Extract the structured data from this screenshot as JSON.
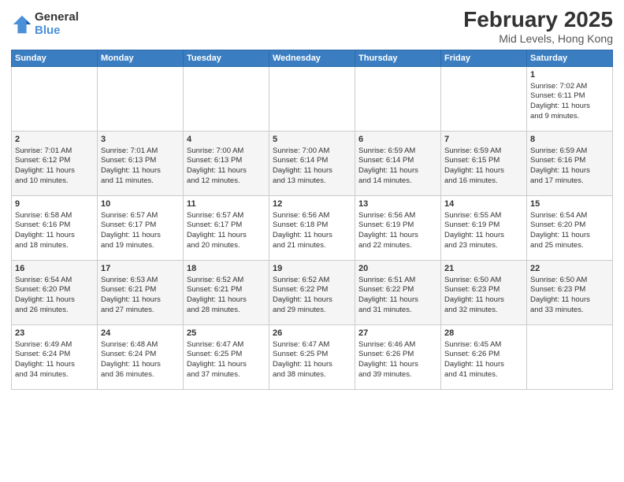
{
  "header": {
    "logo_general": "General",
    "logo_blue": "Blue",
    "title": "February 2025",
    "subtitle": "Mid Levels, Hong Kong"
  },
  "weekdays": [
    "Sunday",
    "Monday",
    "Tuesday",
    "Wednesday",
    "Thursday",
    "Friday",
    "Saturday"
  ],
  "weeks": [
    [
      {
        "day": "",
        "info": ""
      },
      {
        "day": "",
        "info": ""
      },
      {
        "day": "",
        "info": ""
      },
      {
        "day": "",
        "info": ""
      },
      {
        "day": "",
        "info": ""
      },
      {
        "day": "",
        "info": ""
      },
      {
        "day": "1",
        "info": "Sunrise: 7:02 AM\nSunset: 6:11 PM\nDaylight: 11 hours\nand 9 minutes."
      }
    ],
    [
      {
        "day": "2",
        "info": "Sunrise: 7:01 AM\nSunset: 6:12 PM\nDaylight: 11 hours\nand 10 minutes."
      },
      {
        "day": "3",
        "info": "Sunrise: 7:01 AM\nSunset: 6:13 PM\nDaylight: 11 hours\nand 11 minutes."
      },
      {
        "day": "4",
        "info": "Sunrise: 7:00 AM\nSunset: 6:13 PM\nDaylight: 11 hours\nand 12 minutes."
      },
      {
        "day": "5",
        "info": "Sunrise: 7:00 AM\nSunset: 6:14 PM\nDaylight: 11 hours\nand 13 minutes."
      },
      {
        "day": "6",
        "info": "Sunrise: 6:59 AM\nSunset: 6:14 PM\nDaylight: 11 hours\nand 14 minutes."
      },
      {
        "day": "7",
        "info": "Sunrise: 6:59 AM\nSunset: 6:15 PM\nDaylight: 11 hours\nand 16 minutes."
      },
      {
        "day": "8",
        "info": "Sunrise: 6:59 AM\nSunset: 6:16 PM\nDaylight: 11 hours\nand 17 minutes."
      }
    ],
    [
      {
        "day": "9",
        "info": "Sunrise: 6:58 AM\nSunset: 6:16 PM\nDaylight: 11 hours\nand 18 minutes."
      },
      {
        "day": "10",
        "info": "Sunrise: 6:57 AM\nSunset: 6:17 PM\nDaylight: 11 hours\nand 19 minutes."
      },
      {
        "day": "11",
        "info": "Sunrise: 6:57 AM\nSunset: 6:17 PM\nDaylight: 11 hours\nand 20 minutes."
      },
      {
        "day": "12",
        "info": "Sunrise: 6:56 AM\nSunset: 6:18 PM\nDaylight: 11 hours\nand 21 minutes."
      },
      {
        "day": "13",
        "info": "Sunrise: 6:56 AM\nSunset: 6:19 PM\nDaylight: 11 hours\nand 22 minutes."
      },
      {
        "day": "14",
        "info": "Sunrise: 6:55 AM\nSunset: 6:19 PM\nDaylight: 11 hours\nand 23 minutes."
      },
      {
        "day": "15",
        "info": "Sunrise: 6:54 AM\nSunset: 6:20 PM\nDaylight: 11 hours\nand 25 minutes."
      }
    ],
    [
      {
        "day": "16",
        "info": "Sunrise: 6:54 AM\nSunset: 6:20 PM\nDaylight: 11 hours\nand 26 minutes."
      },
      {
        "day": "17",
        "info": "Sunrise: 6:53 AM\nSunset: 6:21 PM\nDaylight: 11 hours\nand 27 minutes."
      },
      {
        "day": "18",
        "info": "Sunrise: 6:52 AM\nSunset: 6:21 PM\nDaylight: 11 hours\nand 28 minutes."
      },
      {
        "day": "19",
        "info": "Sunrise: 6:52 AM\nSunset: 6:22 PM\nDaylight: 11 hours\nand 29 minutes."
      },
      {
        "day": "20",
        "info": "Sunrise: 6:51 AM\nSunset: 6:22 PM\nDaylight: 11 hours\nand 31 minutes."
      },
      {
        "day": "21",
        "info": "Sunrise: 6:50 AM\nSunset: 6:23 PM\nDaylight: 11 hours\nand 32 minutes."
      },
      {
        "day": "22",
        "info": "Sunrise: 6:50 AM\nSunset: 6:23 PM\nDaylight: 11 hours\nand 33 minutes."
      }
    ],
    [
      {
        "day": "23",
        "info": "Sunrise: 6:49 AM\nSunset: 6:24 PM\nDaylight: 11 hours\nand 34 minutes."
      },
      {
        "day": "24",
        "info": "Sunrise: 6:48 AM\nSunset: 6:24 PM\nDaylight: 11 hours\nand 36 minutes."
      },
      {
        "day": "25",
        "info": "Sunrise: 6:47 AM\nSunset: 6:25 PM\nDaylight: 11 hours\nand 37 minutes."
      },
      {
        "day": "26",
        "info": "Sunrise: 6:47 AM\nSunset: 6:25 PM\nDaylight: 11 hours\nand 38 minutes."
      },
      {
        "day": "27",
        "info": "Sunrise: 6:46 AM\nSunset: 6:26 PM\nDaylight: 11 hours\nand 39 minutes."
      },
      {
        "day": "28",
        "info": "Sunrise: 6:45 AM\nSunset: 6:26 PM\nDaylight: 11 hours\nand 41 minutes."
      },
      {
        "day": "",
        "info": ""
      }
    ]
  ]
}
